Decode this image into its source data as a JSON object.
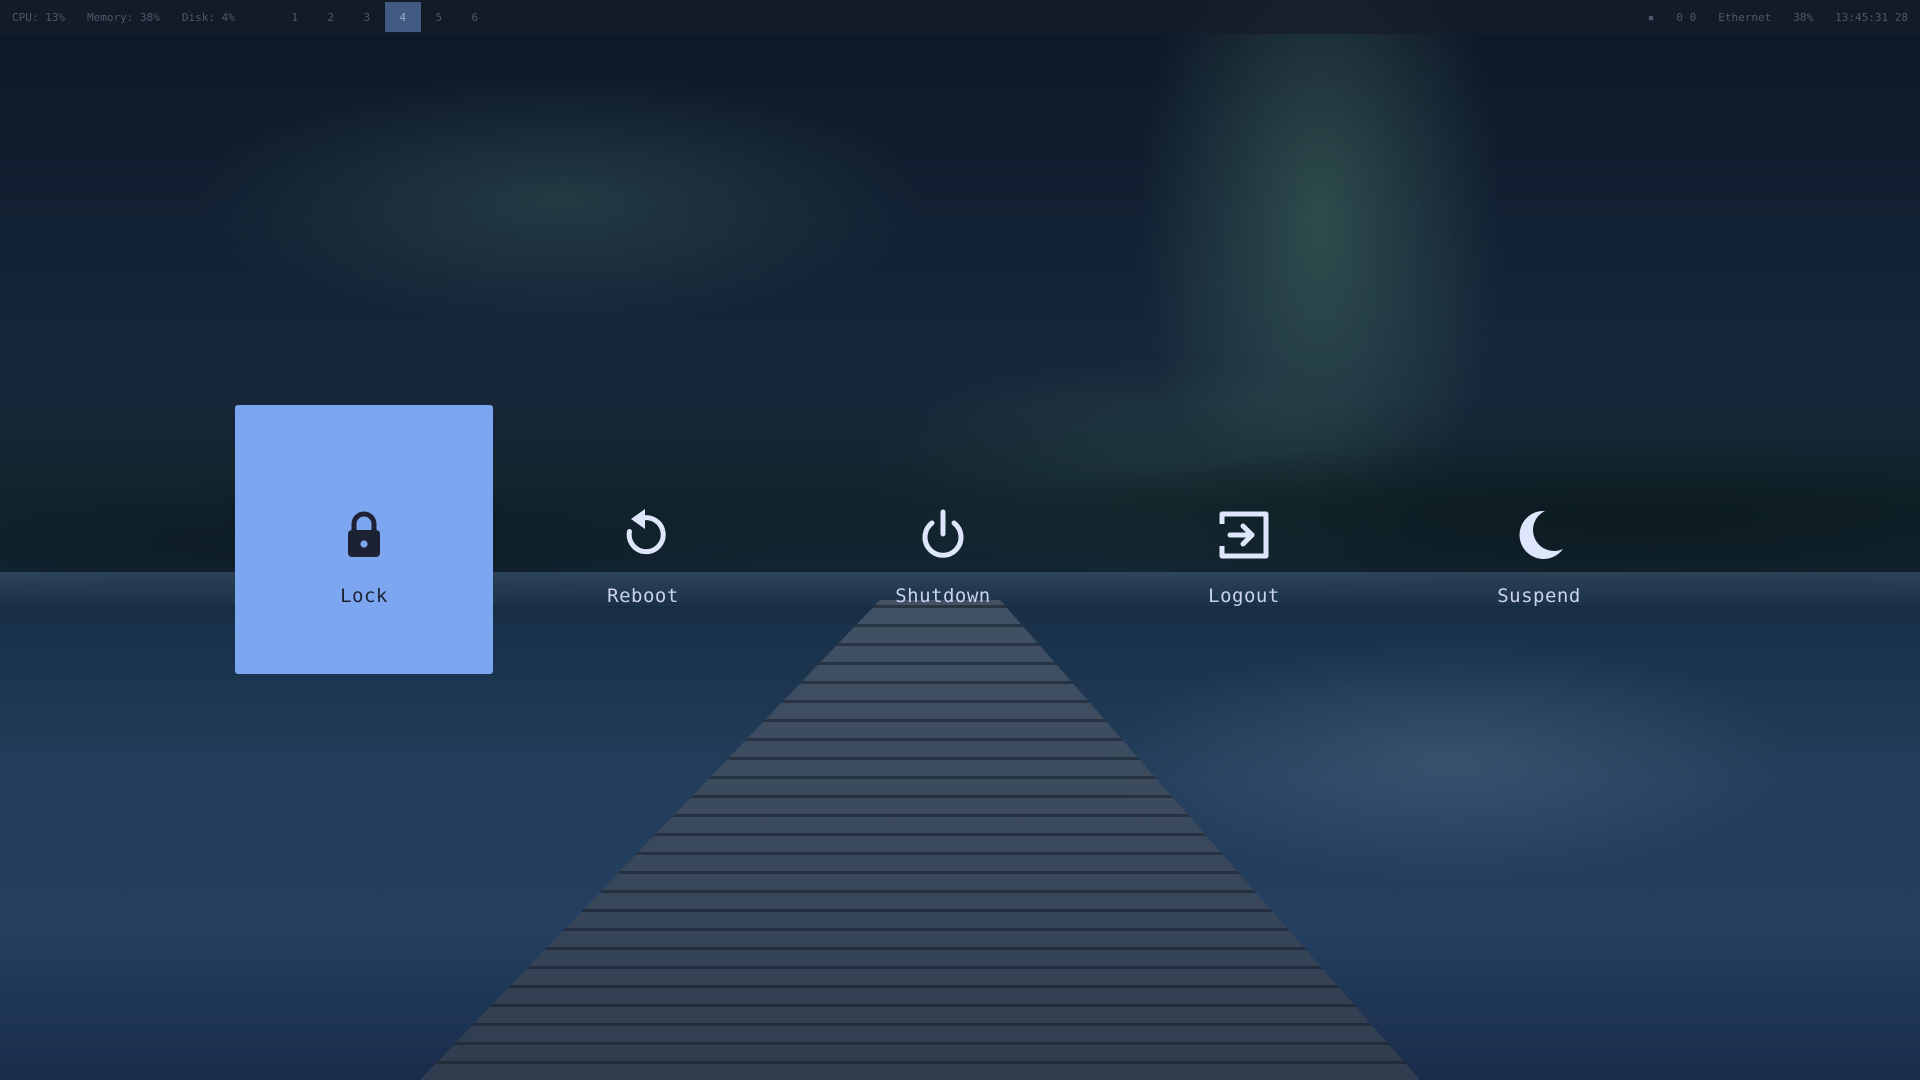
{
  "topbar": {
    "left_items": [
      "CPU: 13%",
      "Memory: 38%",
      "Disk: 4%"
    ],
    "workspaces": [
      "1",
      "2",
      "3",
      "4",
      "5",
      "6"
    ],
    "active_workspace_index": 3,
    "right_items": [
      "",
      "0 0",
      "Ethernet",
      "38%",
      "13:45:31 28"
    ]
  },
  "power_menu": {
    "selected_index": 0,
    "options": [
      {
        "label": "Lock",
        "icon": "lock-icon"
      },
      {
        "label": "Reboot",
        "icon": "reboot-icon"
      },
      {
        "label": "Shutdown",
        "icon": "power-icon"
      },
      {
        "label": "Logout",
        "icon": "logout-icon"
      },
      {
        "label": "Suspend",
        "icon": "moon-icon"
      }
    ]
  },
  "colors": {
    "selected_background": "#7ca7f0",
    "selected_text": "#1c2233",
    "option_text": "#c9d3ec",
    "icon_default": "#dde6fb",
    "icon_selected": "#1c2233"
  }
}
